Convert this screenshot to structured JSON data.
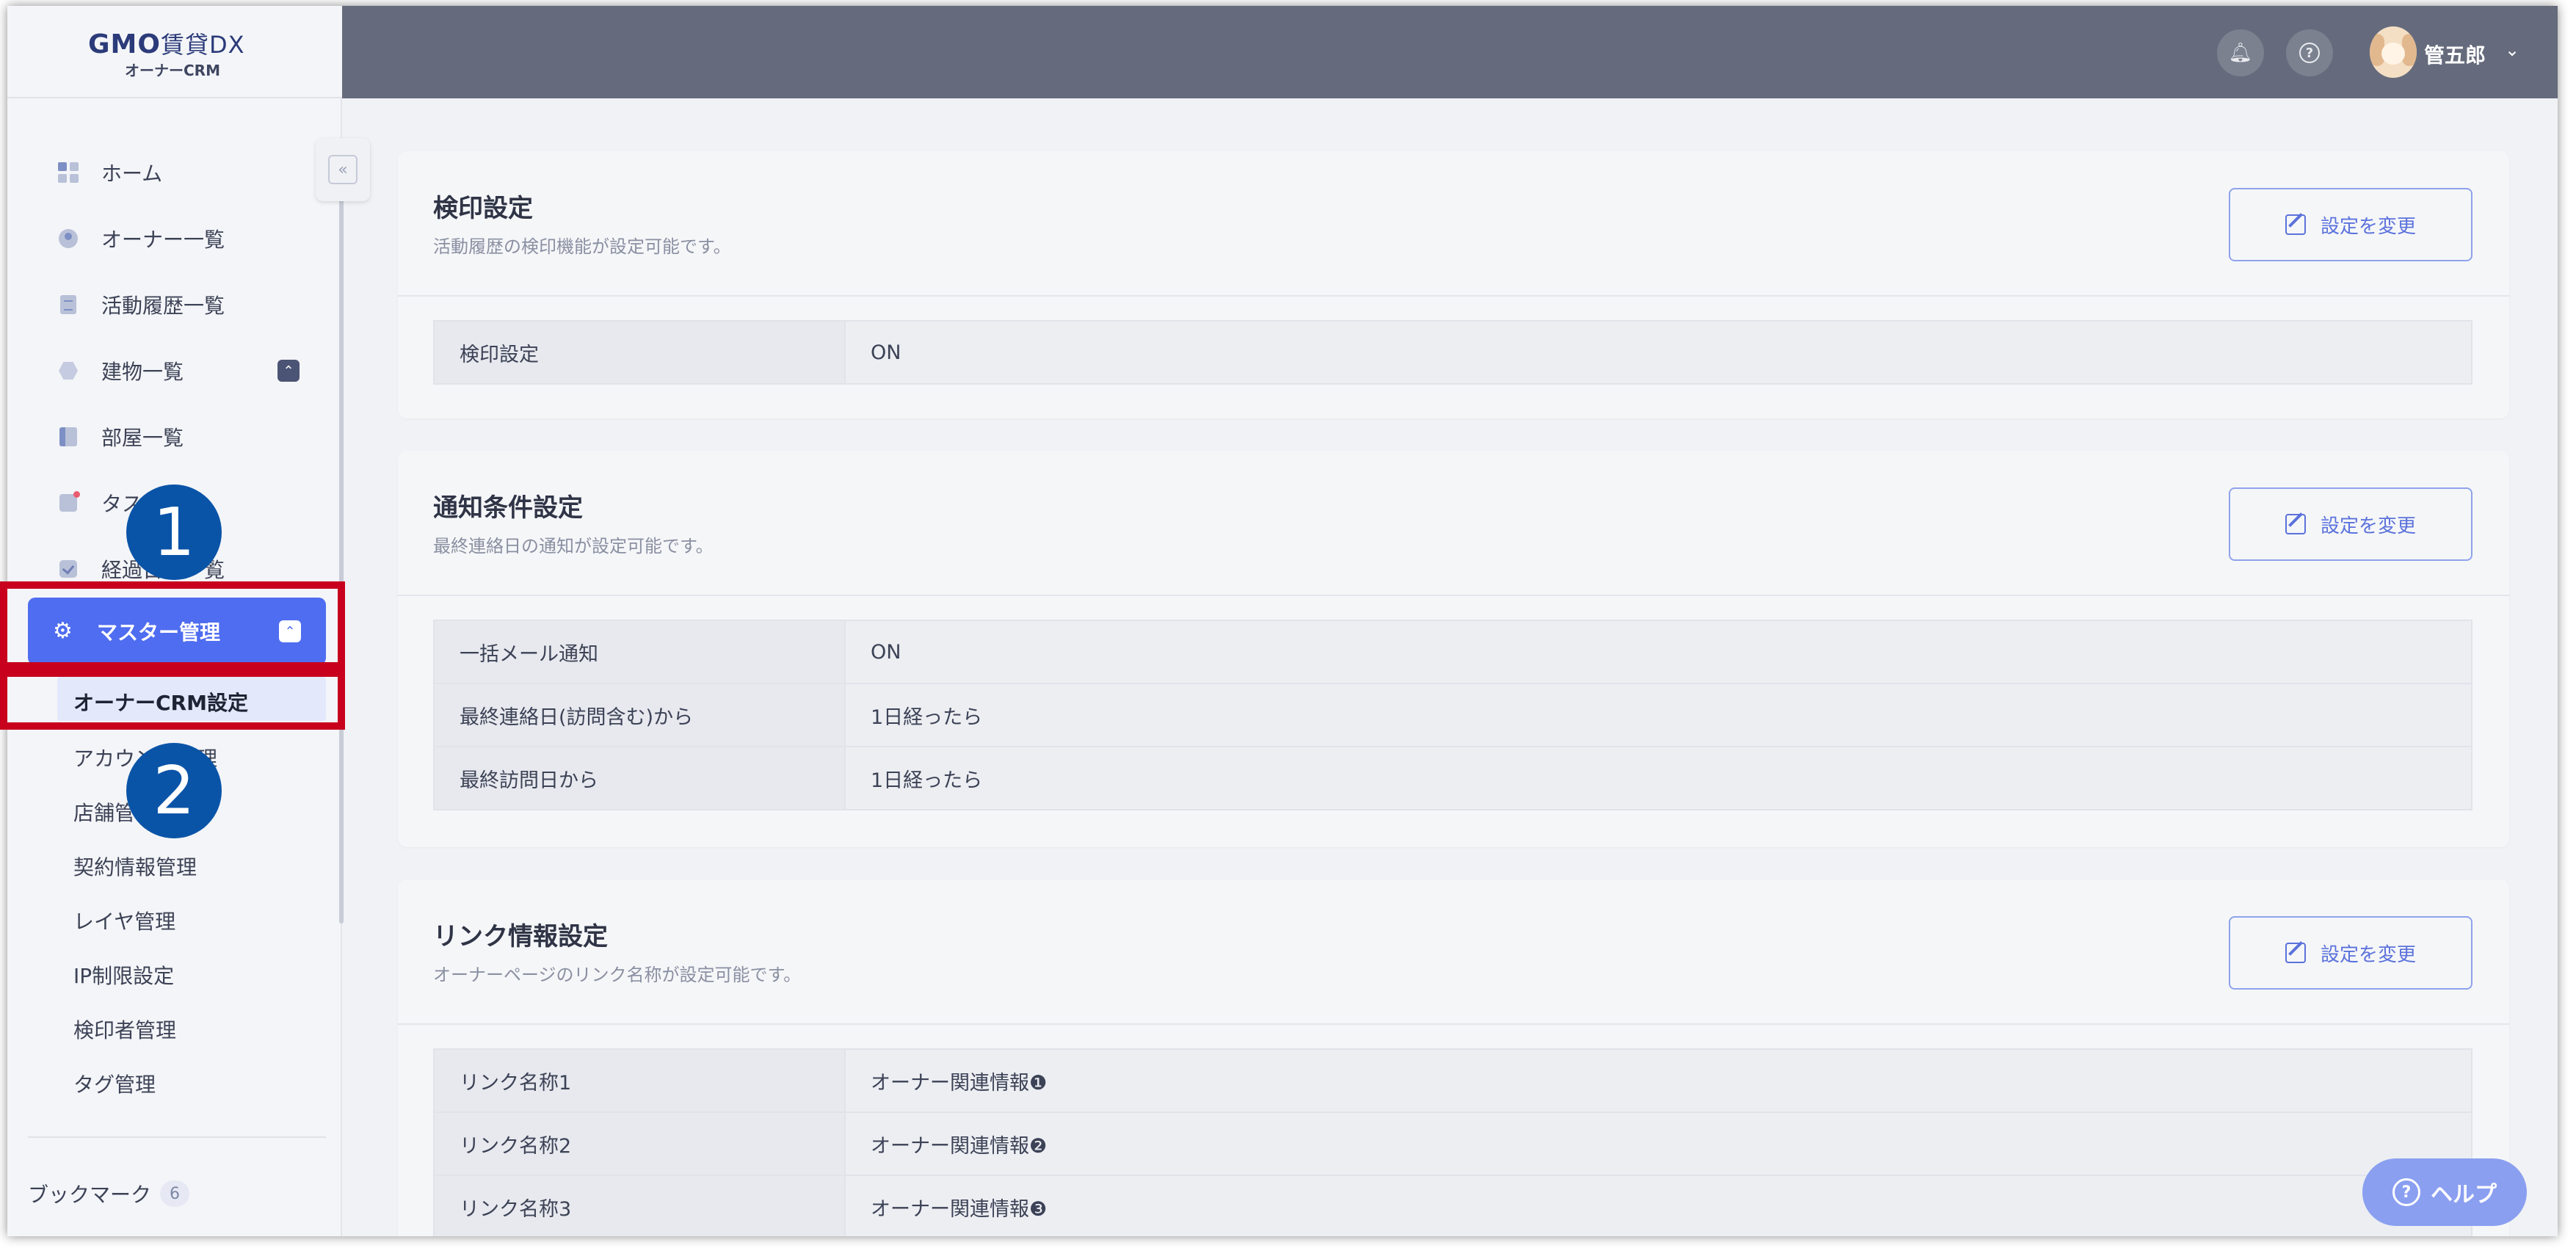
{
  "app": {
    "logo_brand": "GMO",
    "logo_suffix": "賃貸DX",
    "logo_sub": "オーナーCRM"
  },
  "header": {
    "user_name": "管五郎",
    "icons": [
      "bell-icon",
      "help-icon",
      "avatar",
      "chevron-down-icon"
    ]
  },
  "sidebar": {
    "items": [
      {
        "label": "ホーム",
        "icon": "home-grid-icon"
      },
      {
        "label": "オーナー一覧",
        "icon": "owner-icon"
      },
      {
        "label": "活動履歴一覧",
        "icon": "activity-doc-icon"
      },
      {
        "label": "建物一覧",
        "icon": "building-icon"
      },
      {
        "label": "部屋一覧",
        "icon": "room-icon"
      },
      {
        "label": "タスク",
        "icon": "task-icon"
      },
      {
        "label": "経過日数一覧",
        "icon": "check-icon"
      }
    ],
    "master": {
      "label": "マスター管理",
      "icon": "gear-icon"
    },
    "sub_items": [
      {
        "label": "オーナーCRM設定"
      },
      {
        "label": "アカウント管理"
      },
      {
        "label": "店舗管理"
      },
      {
        "label": "契約情報管理"
      },
      {
        "label": "レイヤ管理"
      },
      {
        "label": "IP制限設定"
      },
      {
        "label": "検印者管理"
      },
      {
        "label": "タグ管理"
      }
    ],
    "bookmark": {
      "label": "ブックマーク",
      "count": "6"
    }
  },
  "cards": {
    "stamp": {
      "title": "検印設定",
      "desc": "活動履歴の検印機能が設定可能です。",
      "button": "設定を変更",
      "rows": [
        {
          "key": "検印設定",
          "value": "ON"
        }
      ]
    },
    "notify": {
      "title": "通知条件設定",
      "desc": "最終連絡日の通知が設定可能です。",
      "button": "設定を変更",
      "rows": [
        {
          "key": "一括メール通知",
          "value": "ON"
        },
        {
          "key": "最終連絡日(訪問含む)から",
          "value": "1日経ったら"
        },
        {
          "key": "最終訪問日から",
          "value": "1日経ったら"
        }
      ]
    },
    "link": {
      "title": "リンク情報設定",
      "desc": "オーナーページのリンク名称が設定可能です。",
      "button": "設定を変更",
      "rows": [
        {
          "key": "リンク名称1",
          "value": "オーナー関連情報❶"
        },
        {
          "key": "リンク名称2",
          "value": "オーナー関連情報❷"
        },
        {
          "key": "リンク名称3",
          "value": "オーナー関連情報❸"
        }
      ]
    }
  },
  "help_fab": {
    "label": "ヘルプ"
  },
  "annotations": {
    "step1": "1",
    "step2": "2",
    "highlight_color": "#c8001e",
    "step_color": "#0a54a8"
  },
  "colors": {
    "accent": "#4f6df0",
    "header_bg": "#656b7c"
  }
}
